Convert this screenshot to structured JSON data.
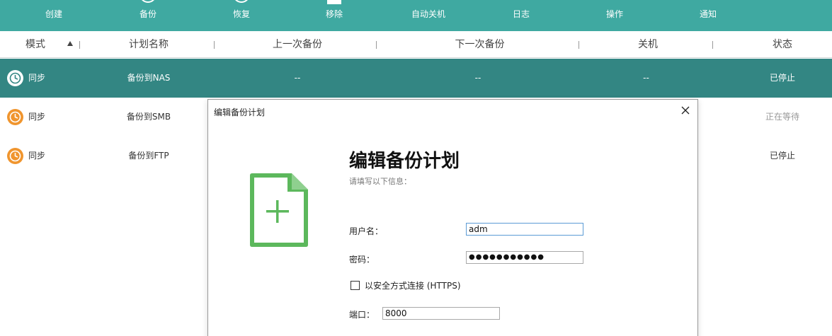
{
  "toolbar": {
    "items": [
      {
        "label": "创建",
        "icon": "plus-icon"
      },
      {
        "label": "备份",
        "icon": "backup-icon"
      },
      {
        "label": "恢复",
        "icon": "restore-icon"
      },
      {
        "label": "移除",
        "icon": "trash-icon"
      },
      {
        "label": "自动关机",
        "icon": "power-icon"
      },
      {
        "label": "日志",
        "icon": "log-icon"
      },
      {
        "label": "操作",
        "icon": "action-icon"
      },
      {
        "label": "通知",
        "icon": "bell-icon"
      }
    ],
    "background": "#3fa9a1"
  },
  "table": {
    "columns": [
      "模式",
      "计划名称",
      "上一次备份",
      "下一次备份",
      "关机",
      "状态"
    ],
    "sorted_column": "模式",
    "sort_direction": "ascending",
    "rows": [
      {
        "mode": "同步",
        "name": "备份到NAS",
        "last": "--",
        "next": "--",
        "shutdown": "--",
        "status": "已停止",
        "selected": true
      },
      {
        "mode": "同步",
        "name": "备份到SMB",
        "last": "",
        "next": "",
        "shutdown": "",
        "status": "正在等待",
        "selected": false
      },
      {
        "mode": "同步",
        "name": "备份到FTP",
        "last": "",
        "next": "",
        "shutdown": "",
        "status": "已停止",
        "selected": false
      }
    ],
    "selected_row_color": "#338683"
  },
  "dialog": {
    "window_title": "编辑备份计划",
    "heading": "编辑备份计划",
    "subheading": "请填写以下信息：",
    "username_label": "用户名：",
    "username_value": "adm",
    "password_label": "密码：",
    "password_masked": "●●●●●●●●●●●",
    "https_label": "以安全方式连接 (HTTPS)",
    "https_checked": false,
    "port_label": "端口：",
    "port_value": "8000",
    "icon": "new-document-icon",
    "icon_color": "#5cb85c"
  }
}
